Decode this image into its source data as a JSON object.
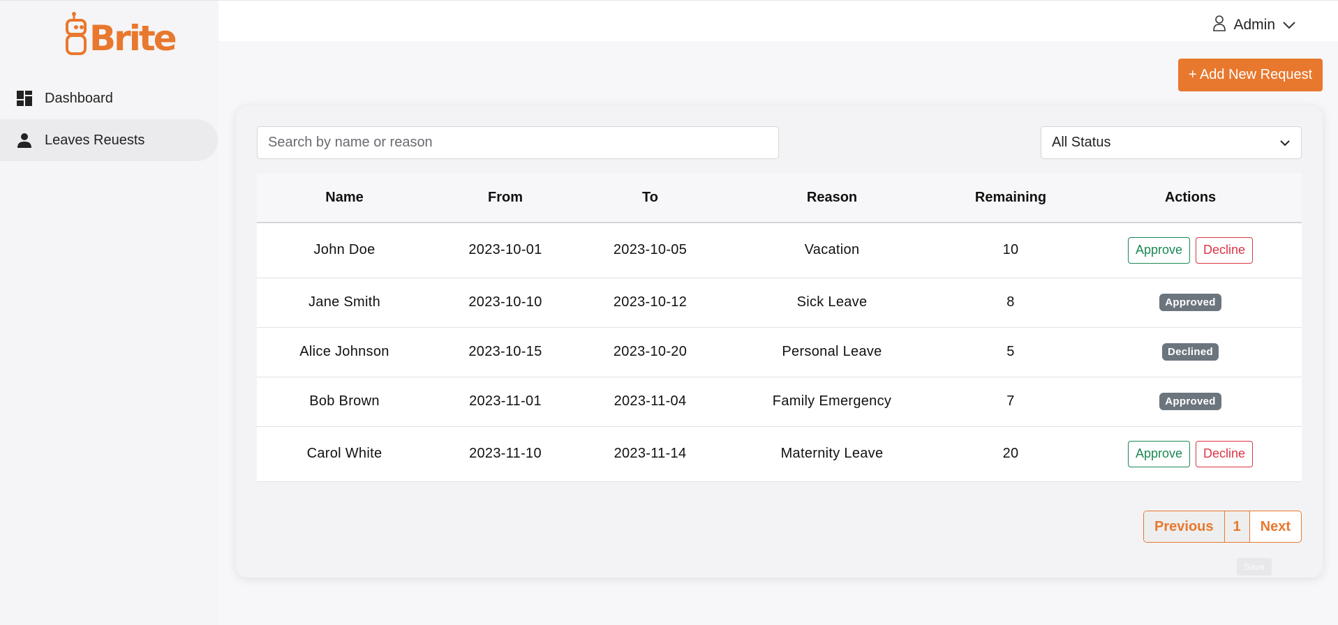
{
  "brand": {
    "name": "Brite",
    "color": "#e8782e"
  },
  "sidebar": {
    "items": [
      {
        "label": "Dashboard",
        "icon": "dashboard-icon"
      },
      {
        "label": "Leaves Reuests",
        "icon": "person-icon"
      }
    ]
  },
  "header": {
    "user_label": "Admin"
  },
  "actions": {
    "add_request_label": "+ Add New Request"
  },
  "filters": {
    "search_placeholder": "Search by name or reason",
    "status_selected": "All Status"
  },
  "table": {
    "headers": [
      "Name",
      "From",
      "To",
      "Reason",
      "Remaining",
      "Actions"
    ],
    "approve_label": "Approve",
    "decline_label": "Decline",
    "rows": [
      {
        "name": "John Doe",
        "from": "2023-10-01",
        "to": "2023-10-05",
        "reason": "Vacation",
        "remaining": "10",
        "status": "pending"
      },
      {
        "name": "Jane Smith",
        "from": "2023-10-10",
        "to": "2023-10-12",
        "reason": "Sick Leave",
        "remaining": "8",
        "status": "Approved"
      },
      {
        "name": "Alice Johnson",
        "from": "2023-10-15",
        "to": "2023-10-20",
        "reason": "Personal Leave",
        "remaining": "5",
        "status": "Declined"
      },
      {
        "name": "Bob Brown",
        "from": "2023-11-01",
        "to": "2023-11-04",
        "reason": "Family Emergency",
        "remaining": "7",
        "status": "Approved"
      },
      {
        "name": "Carol White",
        "from": "2023-11-10",
        "to": "2023-11-14",
        "reason": "Maternity Leave",
        "remaining": "20",
        "status": "pending"
      }
    ]
  },
  "pagination": {
    "previous_label": "Previous",
    "current_page": "1",
    "next_label": "Next"
  },
  "save_label": "Save",
  "colors": {
    "accent": "#e8782e",
    "approve": "#198754",
    "decline": "#dc3545",
    "badge": "#6c757d"
  }
}
